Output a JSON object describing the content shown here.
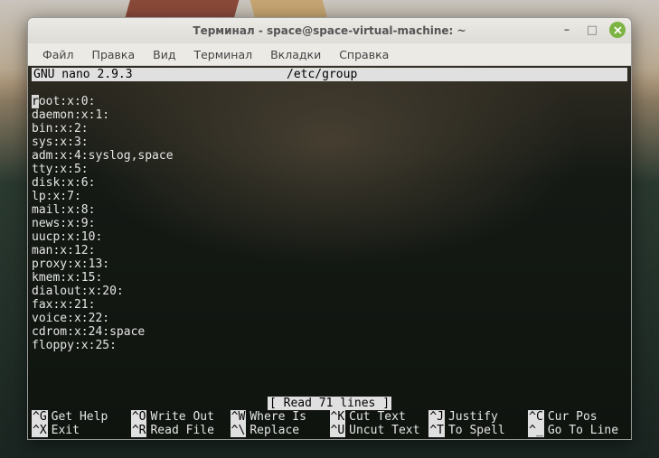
{
  "window": {
    "title": "Терминал - space@space-virtual-machine: ~"
  },
  "menubar": {
    "file": "Файл",
    "edit": "Правка",
    "view": "Вид",
    "terminal": "Терминал",
    "tabs": "Вкладки",
    "help": "Справка"
  },
  "nano": {
    "header_left": "GNU nano 2.9.3",
    "header_file": "/etc/group",
    "status_msg": "[ Read 71 lines ]",
    "cursor_char": "r",
    "lines": [
      "oot:x:0:",
      "daemon:x:1:",
      "bin:x:2:",
      "sys:x:3:",
      "adm:x:4:syslog,space",
      "tty:x:5:",
      "disk:x:6:",
      "lp:x:7:",
      "mail:x:8:",
      "news:x:9:",
      "uucp:x:10:",
      "man:x:12:",
      "proxy:x:13:",
      "kmem:x:15:",
      "dialout:x:20:",
      "fax:x:21:",
      "voice:x:22:",
      "cdrom:x:24:space",
      "floppy:x:25:"
    ],
    "shortcuts": {
      "row1": [
        {
          "key": "^G",
          "label": "Get Help"
        },
        {
          "key": "^O",
          "label": "Write Out"
        },
        {
          "key": "^W",
          "label": "Where Is"
        },
        {
          "key": "^K",
          "label": "Cut Text"
        },
        {
          "key": "^J",
          "label": "Justify"
        },
        {
          "key": "^C",
          "label": "Cur Pos"
        }
      ],
      "row2": [
        {
          "key": "^X",
          "label": "Exit"
        },
        {
          "key": "^R",
          "label": "Read File"
        },
        {
          "key": "^\\",
          "label": "Replace"
        },
        {
          "key": "^U",
          "label": "Uncut Text"
        },
        {
          "key": "^T",
          "label": "To Spell"
        },
        {
          "key": "^_",
          "label": "Go To Line"
        }
      ]
    }
  }
}
